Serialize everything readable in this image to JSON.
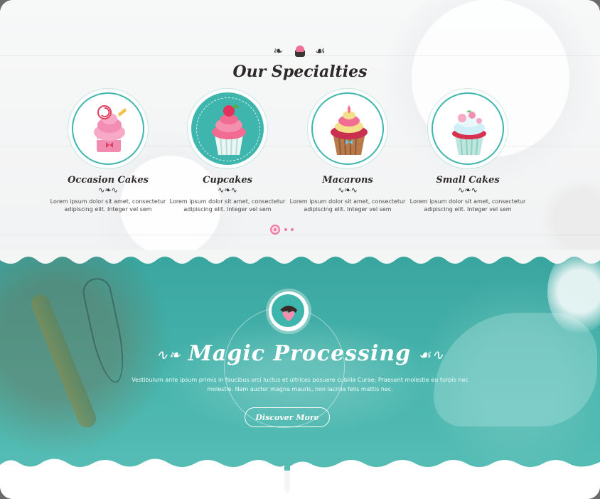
{
  "header": {
    "ornament": "~~",
    "title": "Our Specialties"
  },
  "specialties": [
    {
      "title": "Occasion Cakes",
      "text": "Lorem ipsum dolor sit amet, consectetur adipiscing elit. Integer vel sem",
      "icon": "occasion-cake-icon"
    },
    {
      "title": "Cupcakes",
      "text": "Lorem ipsum dolor sit amet, consectetur adipiscing elit. Integer vel sem",
      "icon": "cupcake-icon"
    },
    {
      "title": "Macarons",
      "text": "Lorem ipsum dolor sit amet, consectetur adipiscing elit. Integer vel sem",
      "icon": "macaron-cupcake-icon"
    },
    {
      "title": "Small Cakes",
      "text": "Lorem ipsum dolor sit amet, consectetur adipiscing elit. Integer vel sem",
      "icon": "small-cake-icon"
    }
  ],
  "carousel": {
    "active_index": 0,
    "count": 3
  },
  "magic": {
    "icon": "heart-cake-icon",
    "title": "Magic Processing",
    "text": "Vestibulum ante ipsum primis in faucibus orci luctus et ultrices posuere cubilia Curae; Praesent molestie eu turpis nec molestie. Nam auctor magna mauris, non lacinia felis mattis nec.",
    "button_label": "Discover More"
  },
  "colors": {
    "teal": "#3fb6ad",
    "pink": "#ef7aa0",
    "text_dark": "#2f2a2a"
  }
}
